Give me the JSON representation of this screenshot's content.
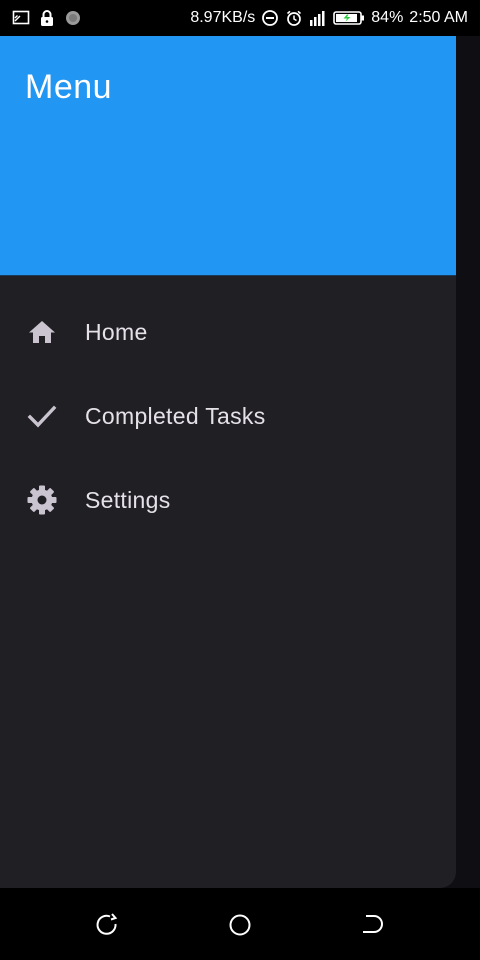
{
  "status_bar": {
    "network_speed": "8.97KB/s",
    "battery_percent": "84%",
    "time": "2:50 AM",
    "left_icons": [
      "screen-cast-icon",
      "lock-icon",
      "circle-dot-icon"
    ],
    "right_icons": [
      "do-not-disturb-icon",
      "alarm-icon",
      "signal-icon",
      "battery-charging-icon"
    ]
  },
  "drawer": {
    "title": "Menu",
    "header_color": "#2196f3",
    "background_color": "#201f24",
    "items": [
      {
        "label": "Home",
        "icon": "home-icon"
      },
      {
        "label": "Completed Tasks",
        "icon": "check-icon"
      },
      {
        "label": "Settings",
        "icon": "gear-icon"
      }
    ]
  },
  "nav_bar": {
    "buttons": [
      "recents-button",
      "home-button",
      "back-button"
    ]
  }
}
